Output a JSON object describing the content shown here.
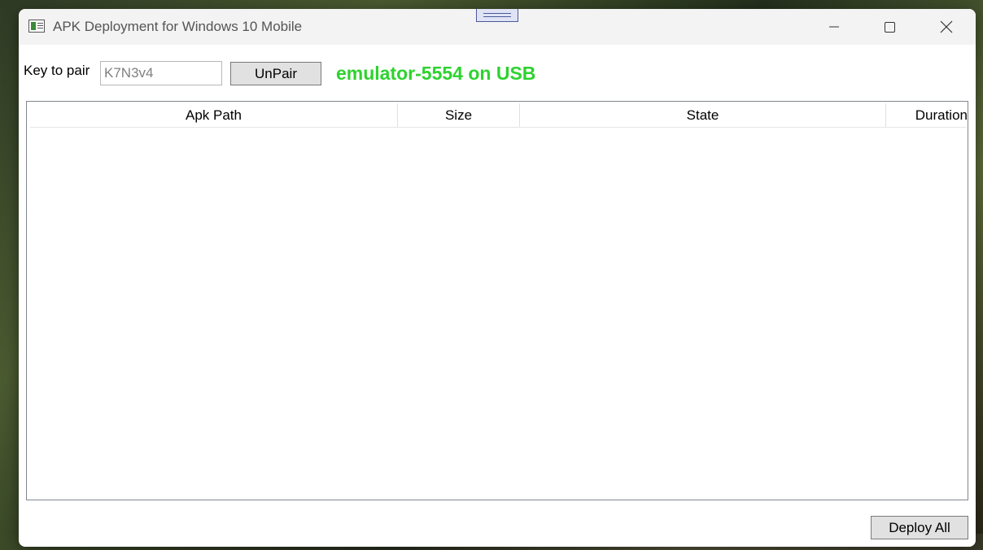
{
  "window": {
    "title": "APK Deployment for Windows 10 Mobile"
  },
  "pairing": {
    "key_label": "Key to pair",
    "key_value": "K7N3v4",
    "unpair_label": "UnPair",
    "status": "emulator-5554 on USB",
    "status_color": "#2ed22e"
  },
  "table": {
    "columns": [
      "Apk Path",
      "Size",
      "State",
      "Duration"
    ],
    "rows": []
  },
  "footer": {
    "deploy_label": "Deploy All"
  }
}
